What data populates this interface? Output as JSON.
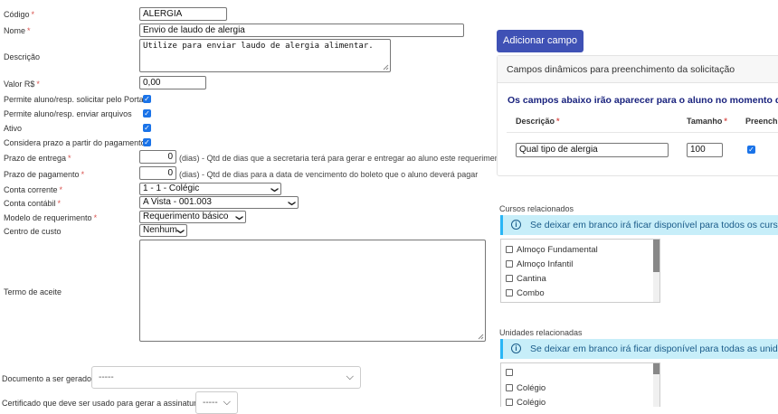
{
  "form": {
    "codigo": {
      "label": "Código",
      "value": "ALERGIA"
    },
    "nome": {
      "label": "Nome",
      "value": "Envio de laudo de alergia"
    },
    "descricao": {
      "label": "Descrição",
      "value": "Utilize para enviar laudo de alergia alimentar."
    },
    "valor": {
      "label": "Valor R$",
      "value": "0,00"
    },
    "permite_solicitar": {
      "label": "Permite aluno/resp. solicitar pelo Portal",
      "checked": true
    },
    "permite_arquivos": {
      "label": "Permite aluno/resp. enviar arquivos",
      "checked": true
    },
    "ativo": {
      "label": "Ativo",
      "checked": true
    },
    "considera_prazo": {
      "label": "Considera prazo a partir do pagamento",
      "checked": true
    },
    "prazo_entrega": {
      "label": "Prazo de entrega",
      "value": "0",
      "hint": "(dias) - Qtd de dias que a secretaria terá para gerar e entregar ao aluno este requerimento"
    },
    "prazo_pagamento": {
      "label": "Prazo de pagamento",
      "value": "0",
      "hint": "(dias) - Qtd de dias para a data de vencimento do boleto que o aluno deverá pagar"
    },
    "conta_corrente": {
      "label": "Conta corrente",
      "value": "1 - 1 - Colégic"
    },
    "conta_contabil": {
      "label": "Conta contábil",
      "value": "A Vista - 001.003"
    },
    "modelo_requerimento": {
      "label": "Modelo de requerimento",
      "value": "Requerimento básico"
    },
    "centro_custo": {
      "label": "Centro de custo",
      "value": "Nenhum"
    },
    "termo_aceite": {
      "label": "Termo de aceite",
      "value": ""
    },
    "documento": {
      "label": "Documento a ser gerado",
      "value": "-----"
    },
    "certificado": {
      "label": "Certificado que deve ser usado para gerar a assinatura",
      "value": "-----"
    }
  },
  "required_mark": "*",
  "check_glyph": "✓",
  "dynamic": {
    "add_button": "Adicionar campo",
    "panel_title": "Campos dinâmicos para preenchimento da solicitação",
    "subtitle": "Os campos abaixo irão aparecer para o aluno no momento da soli",
    "col_descricao": "Descrição",
    "col_tamanho": "Tamanho",
    "col_preenchimento": "Preenchi",
    "row": {
      "descricao": "Qual tipo de alergia",
      "tamanho": "100",
      "preenchimento": true
    }
  },
  "cursos": {
    "title": "Cursos relacionados",
    "info": "Se deixar em branco irá ficar disponível para todos os cursos",
    "items": [
      "Almoço Fundamental",
      "Almoço Infantil",
      "Cantina",
      "Combo"
    ]
  },
  "unidades": {
    "title": "Unidades relacionadas",
    "info": "Se deixar em branco irá ficar disponível para todas as unidades",
    "items": [
      "",
      "Colégio",
      "Colégio"
    ]
  },
  "icons": {
    "info": "info-circle-icon",
    "chevron": "chevron-down-icon",
    "check": "checkmark-icon"
  },
  "colors": {
    "primary": "#3f51b5",
    "check": "#1a73e8",
    "info_bg": "#c7eef9",
    "required": "#d9534f"
  }
}
